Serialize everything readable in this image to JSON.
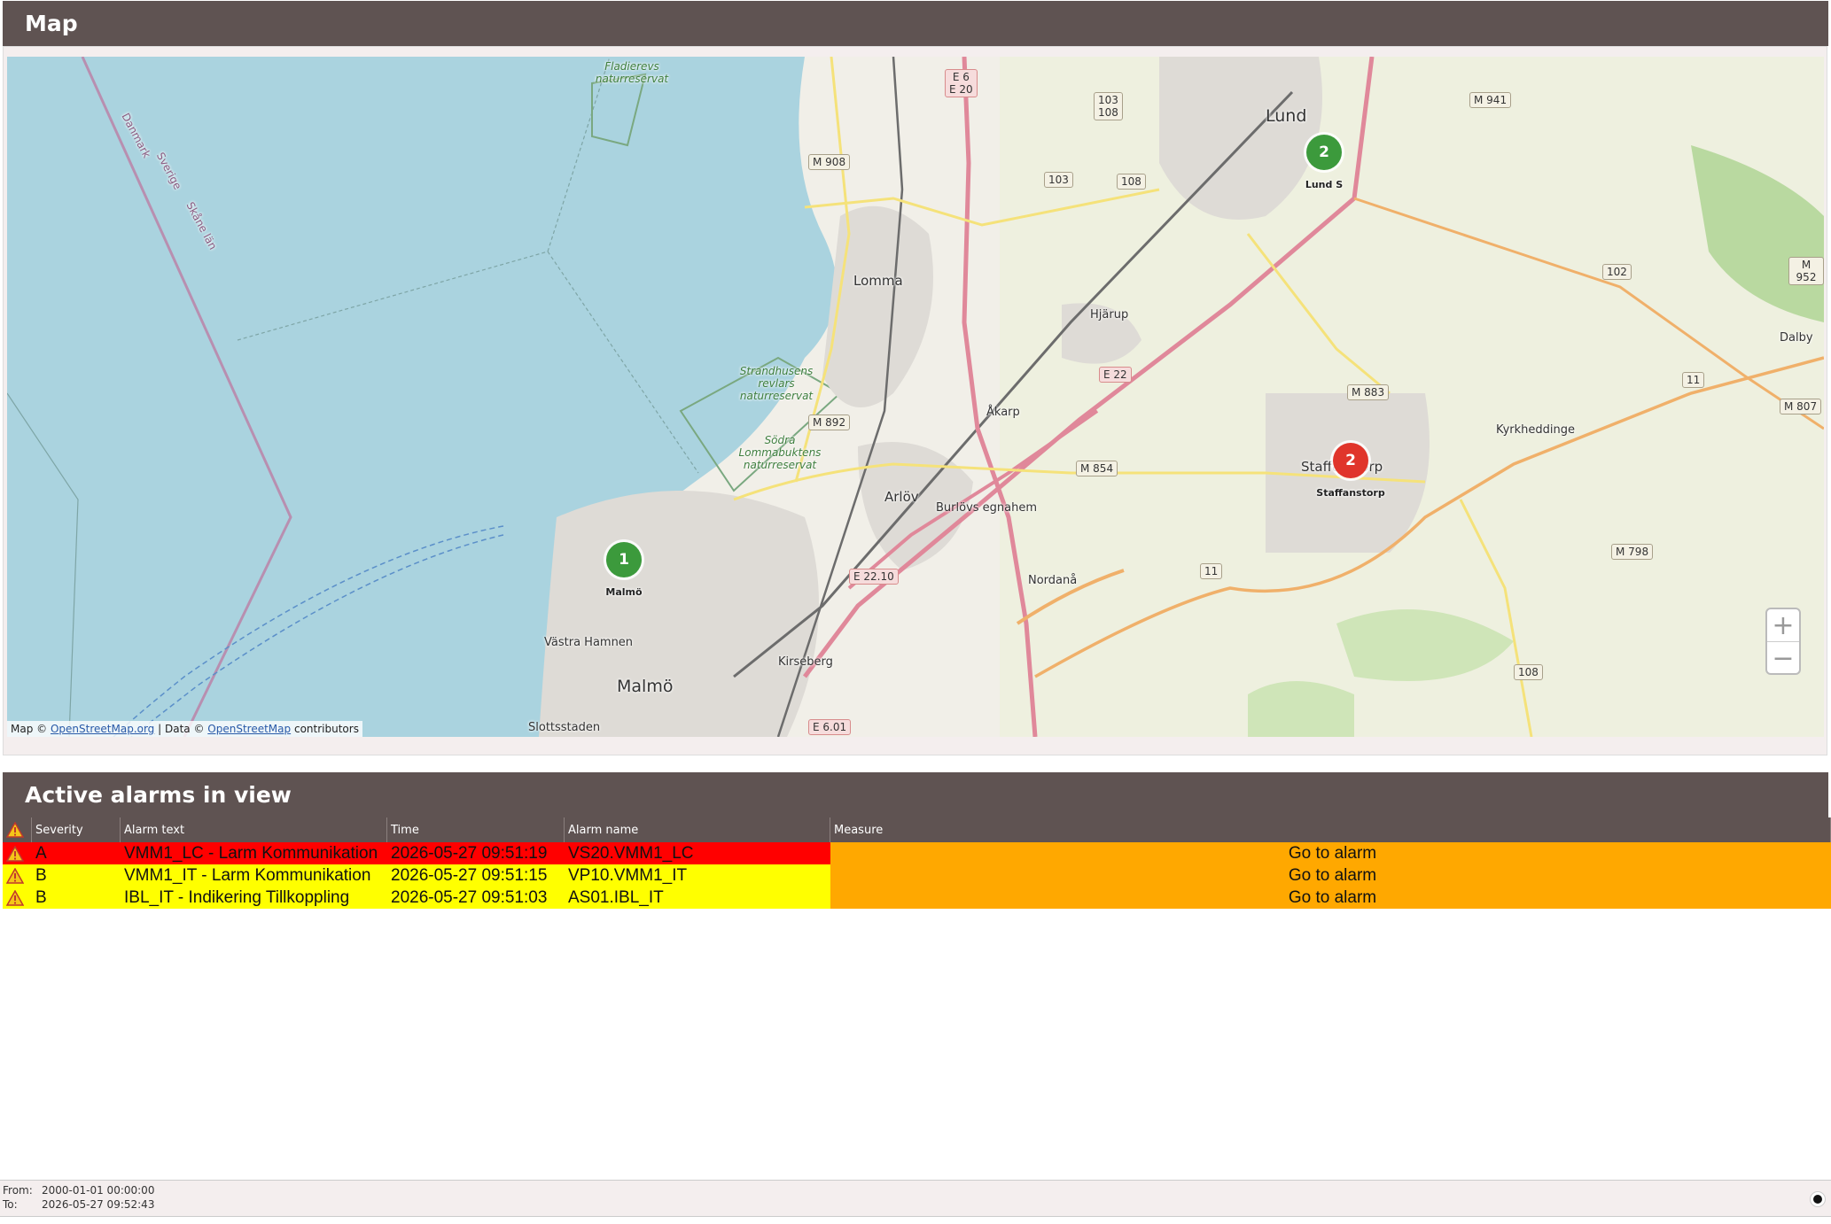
{
  "map_panel": {
    "title": "Map",
    "attribution": {
      "prefix": "Map ©",
      "osm_org": "OpenStreetMap.org",
      "mid": "| Data ©",
      "osm": "OpenStreetMap",
      "suffix": "contributors"
    },
    "zoom_in": "+",
    "zoom_out": "−",
    "markers": [
      {
        "count": "1",
        "label": "Malmö",
        "color": "#3c9a3c"
      },
      {
        "count": "2",
        "label": "Lund S",
        "color": "#3c9a3c"
      },
      {
        "count": "2",
        "label": "Staffanstorp",
        "color": "#e0352b"
      }
    ],
    "places": {
      "lund": "Lund",
      "lomma": "Lomma",
      "arlov": "Arlöv",
      "malmo": "Malmö",
      "staffanstorp": "Staffanstorp",
      "hjarup": "Hjärup",
      "akarp": "Åkarp",
      "burlovs": "Burlövs egnahem",
      "kirseberg": "Kirseberg",
      "vastra_hamnen": "Västra Hamnen",
      "slottsstaden": "Slottsstaden",
      "nordana": "Nordanå",
      "kyrkheddinge": "Kyrkheddinge",
      "dalby": "Dalby",
      "danmark": "Danmark",
      "sverige": "Sverige",
      "skane_lan": "Skåne län",
      "fladierevs": "Fladierevs naturreservat",
      "strandhusens": "Strandhusens revlars naturreservat",
      "sodra_lomma": "Södra Lommabuktens naturreservat"
    },
    "road_shields": {
      "e6_e20": "E 6\nE 20",
      "r103_108": "103\n108",
      "m908": "M 908",
      "r103": "103",
      "r108a": "108",
      "m941": "M 941",
      "m952": "M 952",
      "r102": "102",
      "e22": "E 22",
      "m892": "M 892",
      "m883": "M 883",
      "m854": "M 854",
      "r11a": "11",
      "m807": "M 807",
      "m798": "M 798",
      "e2210": "E 22.10",
      "r11b": "11",
      "r108b": "108",
      "e601": "E 6.01"
    }
  },
  "alarms_panel": {
    "title": "Active alarms in view",
    "columns": [
      "Severity",
      "Alarm text",
      "Time",
      "Alarm name",
      "Measure"
    ],
    "rows": [
      {
        "severity": "A",
        "text": "VMM1_LC - Larm Kommunikation",
        "time": "2026-05-27 09:51:19",
        "name": "VS20.VMM1_LC",
        "measure": "Go to alarm",
        "bg": "#ff0000"
      },
      {
        "severity": "B",
        "text": "VMM1_IT - Larm Kommunikation",
        "time": "2026-05-27 09:51:15",
        "name": "VP10.VMM1_IT",
        "measure": "Go to alarm",
        "bg": "#ffff00"
      },
      {
        "severity": "B",
        "text": "IBL_IT - Indikering Tillkoppling",
        "time": "2026-05-27 09:51:03",
        "name": "AS01.IBL_IT",
        "measure": "Go to alarm",
        "bg": "#ffff00"
      }
    ]
  },
  "footer": {
    "from_label": "From:",
    "from_value": "2000-01-01 00:00:00",
    "to_label": "To:",
    "to_value": "2026-05-27 09:52:43"
  },
  "colors": {
    "header_bg": "#5f5352",
    "measure_bg": "#ffa800",
    "sea": "#aad3df"
  }
}
